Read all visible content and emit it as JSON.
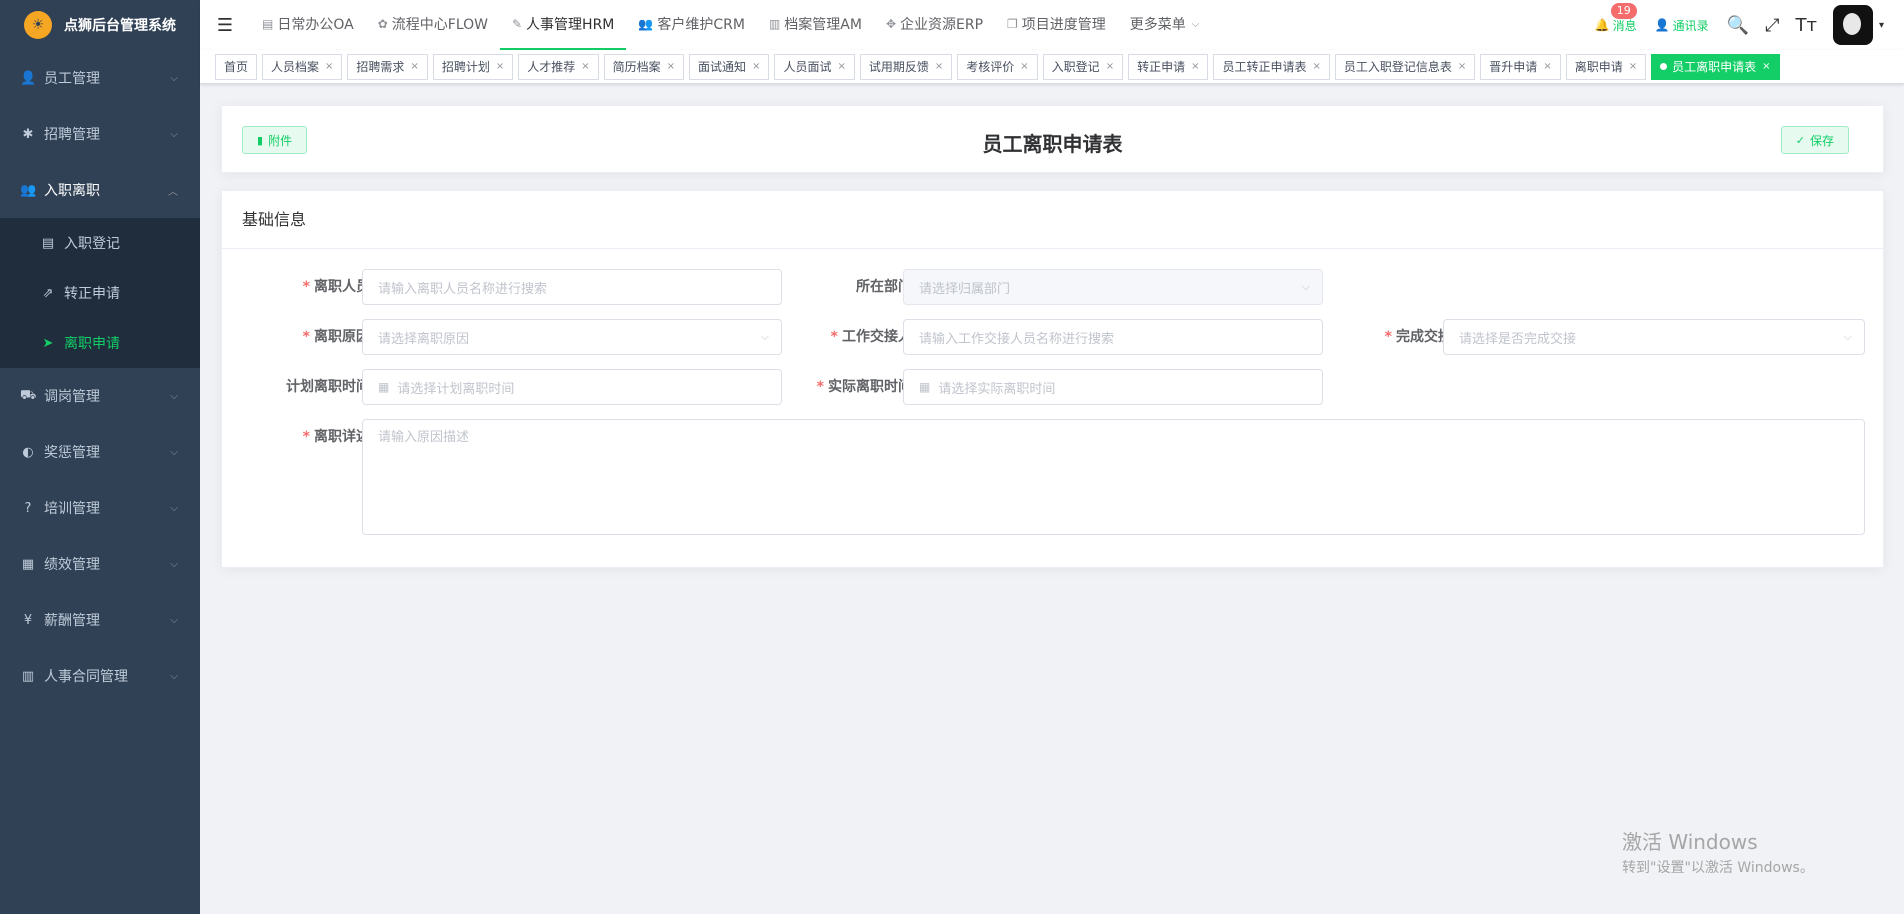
{
  "app": {
    "title": "点狮后台管理系统"
  },
  "sidebar": {
    "items": [
      {
        "label": "员工管理",
        "icon": "user-icon"
      },
      {
        "label": "招聘管理",
        "icon": "bug-icon"
      },
      {
        "label": "入职离职",
        "icon": "users-icon",
        "expanded": true,
        "children": [
          {
            "label": "入职登记",
            "icon": "document-icon"
          },
          {
            "label": "转正申请",
            "icon": "external-link-icon"
          },
          {
            "label": "离职申请",
            "icon": "send-icon",
            "active": true
          }
        ]
      },
      {
        "label": "调岗管理",
        "icon": "cart-icon"
      },
      {
        "label": "奖惩管理",
        "icon": "palette-icon"
      },
      {
        "label": "培训管理",
        "icon": "question-icon"
      },
      {
        "label": "绩效管理",
        "icon": "report-icon"
      },
      {
        "label": "薪酬管理",
        "icon": "yen-icon"
      },
      {
        "label": "人事合同管理",
        "icon": "book-icon"
      }
    ]
  },
  "topnav": {
    "items": [
      "日常办公OA",
      "流程中心FLOW",
      "人事管理HRM",
      "客户维护CRM",
      "档案管理AM",
      "企业资源ERP",
      "项目进度管理",
      "更多菜单"
    ],
    "active": "人事管理HRM"
  },
  "header": {
    "messages_label": "消息",
    "messages_count": "19",
    "contacts_label": "通讯录"
  },
  "tags": [
    "首页",
    "人员档案",
    "招聘需求",
    "招聘计划",
    "人才推荐",
    "简历档案",
    "面试通知",
    "人员面试",
    "试用期反馈",
    "考核评价",
    "入职登记",
    "转正申请",
    "员工转正申请表",
    "员工入职登记信息表",
    "晋升申请",
    "离职申请",
    "员工离职申请表"
  ],
  "activeTag": "员工离职申请表",
  "form": {
    "title": "员工离职申请表",
    "attach_label": "附件",
    "save_label": "保存",
    "section": "基础信息",
    "fields": {
      "leaver": {
        "label": "离职人员",
        "placeholder": "请输入离职人员名称进行搜索",
        "required": true
      },
      "dept": {
        "label": "所在部门",
        "placeholder": "请选择归属部门",
        "required": false
      },
      "reason": {
        "label": "离职原因",
        "placeholder": "请选择离职原因",
        "required": true
      },
      "handover": {
        "label": "工作交接人",
        "placeholder": "请输入工作交接人员名称进行搜索",
        "required": true
      },
      "done": {
        "label": "完成交接",
        "placeholder": "请选择是否完成交接",
        "required": true
      },
      "plan_time": {
        "label": "计划离职时间",
        "placeholder": "请选择计划离职时间",
        "required": false
      },
      "actual_time": {
        "label": "实际离职时间",
        "placeholder": "请选择实际离职时间",
        "required": true
      },
      "detail": {
        "label": "离职详述",
        "placeholder": "请输入原因描述",
        "required": true
      }
    }
  },
  "watermark": {
    "line1": "激活 Windows",
    "line2": "转到\"设置\"以激活 Windows。"
  },
  "colors": {
    "accent": "#13ce66",
    "sidebar": "#304156",
    "required": "#f56c6c"
  }
}
